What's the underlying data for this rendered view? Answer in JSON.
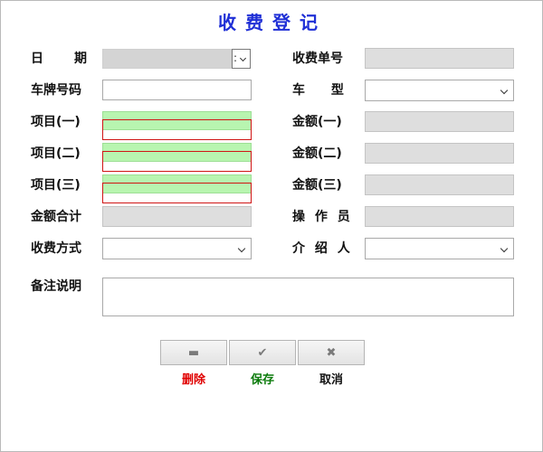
{
  "title": "收费登记",
  "labels": {
    "date": "日 期",
    "receipt_no": "收费单号",
    "plate": "车牌号码",
    "vehicle_type": "车 型",
    "item1": "项目(一)",
    "amount1": "金额(一)",
    "item2": "项目(二)",
    "amount2": "金额(二)",
    "item3": "项目(三)",
    "amount3": "金额(三)",
    "total": "金额合计",
    "operator": "操 作 员",
    "pay_method": "收费方式",
    "referrer": "介 绍 人",
    "remarks": "备注说明"
  },
  "buttons": {
    "delete": {
      "icon": "minus-icon",
      "glyph": "▬",
      "label": "删除",
      "color": "#e00000"
    },
    "save": {
      "icon": "check-icon",
      "glyph": "✔",
      "label": "保存",
      "color": "#0a7a0a"
    },
    "cancel": {
      "icon": "close-icon",
      "glyph": "✖",
      "label": "取消",
      "color": "#111111"
    }
  },
  "date_spinner": ":"
}
